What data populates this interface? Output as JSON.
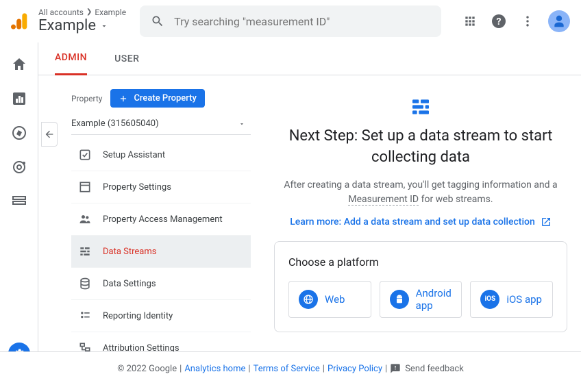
{
  "header": {
    "breadcrumb_root": "All accounts",
    "breadcrumb_leaf": "Example",
    "title": "Example",
    "search_placeholder": "Try searching \"measurement ID\""
  },
  "tabs": {
    "admin": "ADMIN",
    "user": "USER"
  },
  "sidebar": {
    "property_label": "Property",
    "create_button": "Create Property",
    "selected_property": "Example (315605040)",
    "items": [
      "Setup Assistant",
      "Property Settings",
      "Property Access Management",
      "Data Streams",
      "Data Settings",
      "Reporting Identity",
      "Attribution Settings"
    ]
  },
  "panel": {
    "heading": "Next Step: Set up a data stream to start collecting data",
    "body_pre": "After creating a data stream, you'll get tagging information and a ",
    "body_underlined": "Measurement ID",
    "body_post": " for web streams.",
    "learn_more": "Learn more: Add a data stream and set up data collection",
    "choose": "Choose a platform",
    "platforms": {
      "web": "Web",
      "android": "Android app",
      "ios": "iOS app"
    }
  },
  "footer": {
    "copyright": "© 2022 Google",
    "home": "Analytics home",
    "tos": "Terms of Service",
    "privacy": "Privacy Policy",
    "feedback": "Send feedback"
  }
}
